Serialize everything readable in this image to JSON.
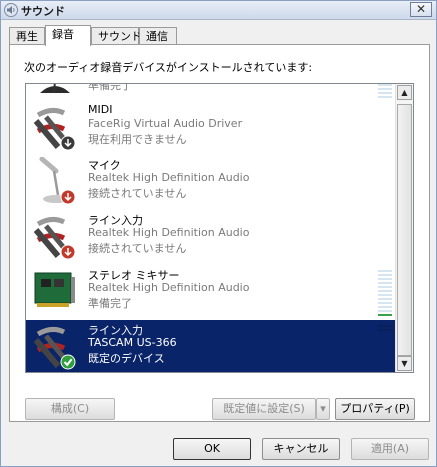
{
  "window": {
    "title": "サウンド",
    "close_glyph": "✕"
  },
  "tabs": [
    {
      "label": "再生"
    },
    {
      "label": "録音"
    },
    {
      "label": "サウンド"
    },
    {
      "label": "通信"
    }
  ],
  "panel": {
    "label": "次のオーディオ録音デバイスがインストールされています:"
  },
  "devices": [
    {
      "name": "",
      "driver": "",
      "status": "準備完了",
      "icon": "microphone-icon"
    },
    {
      "name": "MIDI",
      "driver": "FaceRig Virtual Audio Driver",
      "status": "現在利用できません",
      "icon": "rca-jack-icon"
    },
    {
      "name": "マイク",
      "driver": "Realtek High Definition Audio",
      "status": "接続されていません",
      "icon": "microphone-icon"
    },
    {
      "name": "ライン入力",
      "driver": "Realtek High Definition Audio",
      "status": "接続されていません",
      "icon": "rca-jack-icon"
    },
    {
      "name": "ステレオ ミキサー",
      "driver": "Realtek High Definition Audio",
      "status": "準備完了",
      "icon": "sound-card-icon"
    },
    {
      "name": "ライン入力",
      "driver": "TASCAM US-366",
      "status": "既定のデバイス",
      "icon": "rca-jack-icon"
    }
  ],
  "buttons": {
    "configure": "構成(C)",
    "set_default": "既定値に設定(S)",
    "properties": "プロパティ(P)",
    "ok": "OK",
    "cancel": "キャンセル",
    "apply": "適用(A)"
  },
  "colors": {
    "selection": "#0a246a",
    "meter": "#d6e6f0",
    "meter_active": "#3aa04a"
  }
}
